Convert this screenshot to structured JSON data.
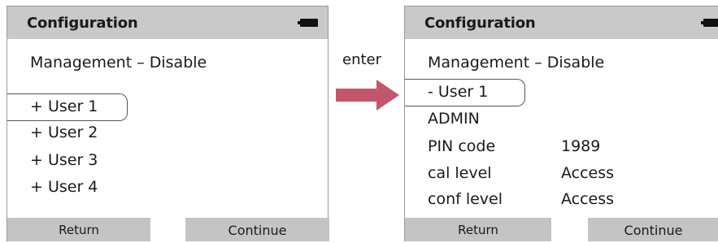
{
  "colors": {
    "title_bar": "#c9c9c9",
    "softkey": "#c4c4c4",
    "arrow": "#c4566b"
  },
  "left_screen": {
    "title": "Configuration",
    "battery_icon": "battery-icon",
    "management_row": "Management – Disable",
    "users": [
      "+ User 1",
      "+ User 2",
      "+ User 3",
      "+ User 4"
    ],
    "selected_index": 0,
    "return_label": "Return",
    "continue_label": "Continue"
  },
  "transition": {
    "label": "enter",
    "icon": "arrow-right-icon"
  },
  "right_screen": {
    "title": "Configuration",
    "battery_icon": "battery-icon",
    "management_row": "Management – Disable",
    "user_row": "- User 1",
    "admin_row": "ADMIN",
    "pin_label": "PIN code",
    "pin_value": "1989",
    "cal_label": "cal level",
    "cal_value": "Access",
    "conf_label": "conf level",
    "conf_value": "Access",
    "return_label": "Return",
    "continue_label": "Continue"
  }
}
